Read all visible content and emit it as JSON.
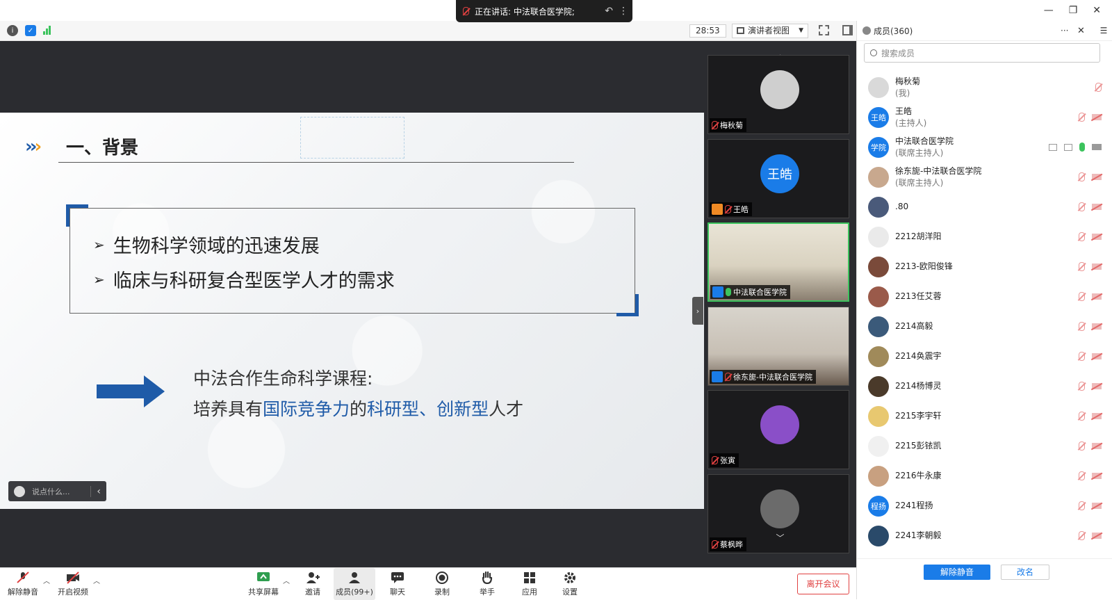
{
  "window": {
    "minimize": "—",
    "restore": "❐",
    "close": "✕"
  },
  "speaking": {
    "label": "正在讲话: 中法联合医学院;"
  },
  "topbar": {
    "timer": "28:53",
    "view_mode": "演讲者视图"
  },
  "slide": {
    "heading": "一、背景",
    "bullets": [
      "生物科学领域的迅速发展",
      "临床与科研复合型医学人才的需求"
    ],
    "course_line1": "中法合作生命科学课程:",
    "course_line2_parts": {
      "p1": "培养具有",
      "h1": "国际竞争力",
      "p2": "的",
      "h2": "科研型",
      "p3": "、",
      "h3": "创新型",
      "p4": "人才"
    },
    "bullet_marker": "➢"
  },
  "chat": {
    "placeholder": "说点什么..."
  },
  "gallery": {
    "tiles": [
      {
        "name": "梅秋菊"
      },
      {
        "name": "王皓",
        "avatar_text": "王皓"
      },
      {
        "name": "中法联合医学院"
      },
      {
        "name": "徐东旎-中法联合医学院"
      },
      {
        "name": "张寅"
      },
      {
        "name": "蔡枫晔"
      }
    ]
  },
  "panel": {
    "title": "成员(360)",
    "more": "···",
    "close": "✕",
    "search_placeholder": "搜索成员",
    "members": [
      {
        "name": "梅秋菊",
        "role": "(我)"
      },
      {
        "name": "王皓",
        "role": "(主持人)",
        "avatar_text": "王皓"
      },
      {
        "name": "中法联合医学院",
        "role": "(联席主持人)",
        "avatar_text": "学院"
      },
      {
        "name": "徐东旎-中法联合医学院",
        "role": "(联席主持人)"
      },
      {
        "name": ".80",
        "role": ""
      },
      {
        "name": "2212胡洋阳",
        "role": ""
      },
      {
        "name": "2213-欧阳俊锋",
        "role": ""
      },
      {
        "name": "2213任艾蓉",
        "role": ""
      },
      {
        "name": "2214高毅",
        "role": ""
      },
      {
        "name": "2214奂震宇",
        "role": ""
      },
      {
        "name": "2214杨博灵",
        "role": ""
      },
      {
        "name": "2215李宇轩",
        "role": ""
      },
      {
        "name": "2215彭铱凯",
        "role": ""
      },
      {
        "name": "2216牛永康",
        "role": ""
      },
      {
        "name": "2241程扬",
        "role": "",
        "avatar_text": "程扬"
      },
      {
        "name": "2241李朝毅",
        "role": ""
      }
    ],
    "unmute_all": "解除静音",
    "rename": "改名"
  },
  "toolbar": {
    "unmute": "解除静音",
    "start_video": "开启视频",
    "share": "共享屏幕",
    "invite": "邀请",
    "members": "成员(99+)",
    "chat": "聊天",
    "record": "录制",
    "raise_hand": "举手",
    "apps": "应用",
    "settings": "设置",
    "leave": "离开会议"
  },
  "colors": {
    "accent": "#1a7ce8",
    "danger": "#e04141",
    "slide_blue": "#1f5ba8",
    "active_green": "#3cc35d"
  }
}
